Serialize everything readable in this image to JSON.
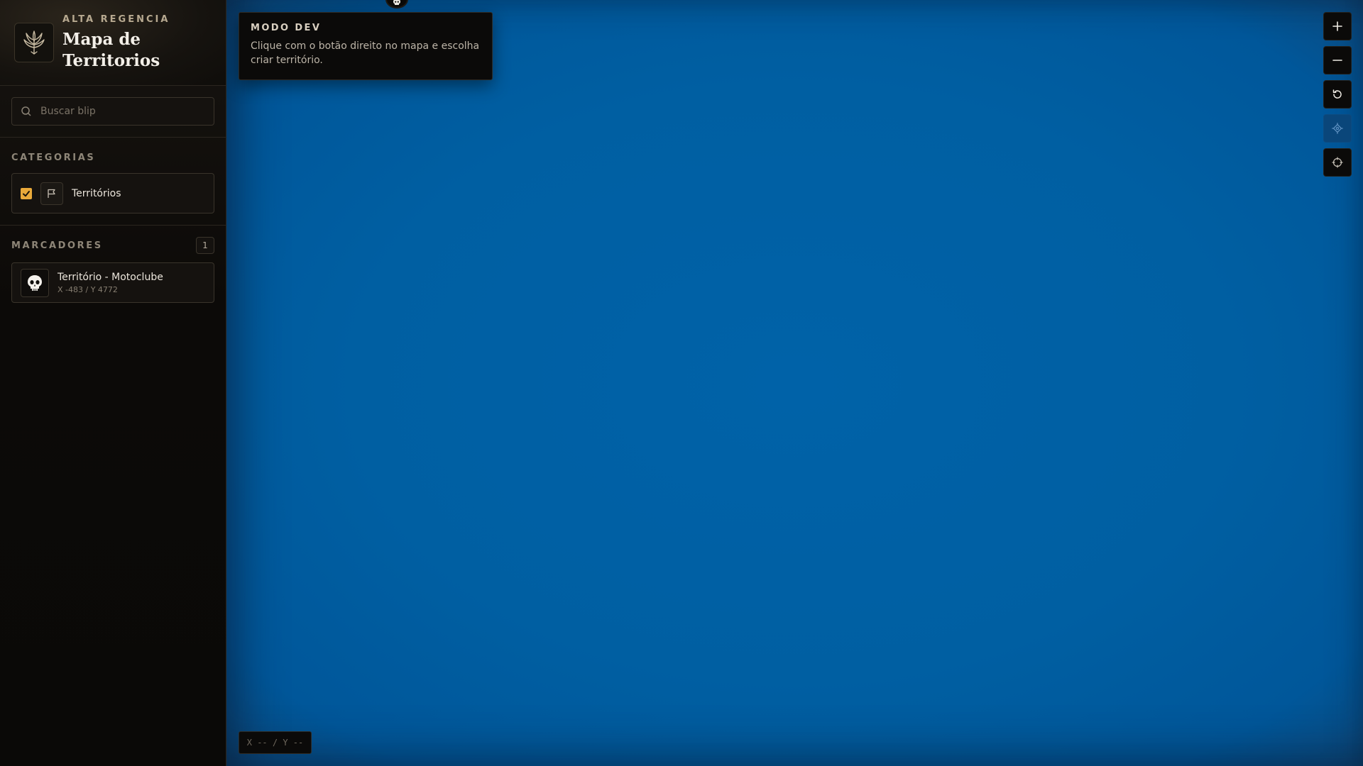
{
  "brand": {
    "kicker": "ALTA REGENCIA",
    "title": "Mapa de Territorios",
    "logo_icon": "dragon-crest-icon"
  },
  "search": {
    "placeholder": "Buscar blip",
    "value": ""
  },
  "categories": {
    "title": "CATEGORIAS",
    "items": [
      {
        "label": "Territórios",
        "checked": true,
        "icon": "flag-icon"
      }
    ]
  },
  "markers": {
    "title": "MARCADORES",
    "count": "1",
    "items": [
      {
        "name": "Território - Motoclube",
        "coords": "X -483 / Y 4772",
        "icon": "skull-icon"
      }
    ]
  },
  "dev_panel": {
    "title": "MODO DEV",
    "text": "Clique com o botão direito no mapa e escolha criar território."
  },
  "controls": [
    {
      "icon": "plus-icon"
    },
    {
      "icon": "minus-icon"
    },
    {
      "icon": "reset-icon"
    },
    {
      "icon": "locate-icon"
    },
    {
      "icon": "crosshair-icon"
    }
  ],
  "coord_readout": "X -- / Y --",
  "colors": {
    "accent": "#e9a93a",
    "map_water": "#005fa2",
    "panel": "#0b0a09"
  }
}
